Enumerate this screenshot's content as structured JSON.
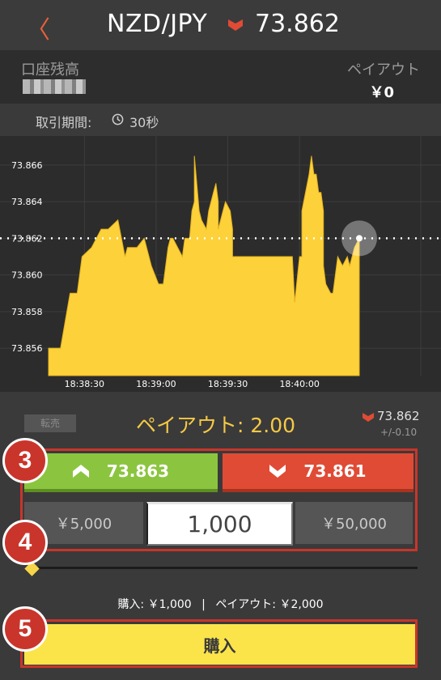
{
  "header": {
    "back_label": "〈",
    "pair": "NZD/JPY",
    "trend": "down",
    "rate": "73.862"
  },
  "account": {
    "balance_label": "口座残高",
    "payout_label": "ペイアウト",
    "payout_value": "￥0"
  },
  "period": {
    "label": "取引期間:",
    "value": "30秒"
  },
  "chart_data": {
    "type": "area",
    "y_ticks": [
      "73.866",
      "73.864",
      "73.862",
      "73.860",
      "73.858",
      "73.856"
    ],
    "x_ticks": [
      "18:38:30",
      "18:39:00",
      "18:39:30",
      "18:40:00"
    ],
    "ylim": [
      73.8545,
      73.8675
    ],
    "current_price": 73.862,
    "color": "#fdd13a",
    "x": [
      0,
      5,
      9,
      12,
      14,
      18,
      22,
      25,
      29,
      32,
      33,
      37,
      40,
      42,
      43,
      46,
      48,
      50,
      51,
      52,
      54,
      56,
      57,
      59,
      60,
      61,
      61,
      63,
      64,
      66,
      67,
      69,
      70,
      71,
      71,
      73,
      74,
      76,
      77,
      77,
      80,
      85,
      90,
      95,
      98,
      102,
      103,
      105,
      106,
      106,
      109,
      110,
      111,
      112,
      113,
      114,
      115,
      115,
      116,
      118,
      119,
      121,
      123,
      125,
      126,
      128,
      130
    ],
    "values": [
      73.856,
      73.856,
      73.859,
      73.859,
      73.861,
      73.8615,
      73.8625,
      73.8625,
      73.863,
      73.861,
      73.8615,
      73.8615,
      73.862,
      73.861,
      73.8605,
      73.8595,
      73.8595,
      73.8615,
      73.862,
      73.862,
      73.8615,
      73.861,
      73.862,
      73.862,
      73.8635,
      73.864,
      73.8665,
      73.8635,
      73.863,
      73.8625,
      73.8635,
      73.8645,
      73.865,
      73.864,
      73.8625,
      73.8635,
      73.864,
      73.8635,
      73.8625,
      73.861,
      73.861,
      73.861,
      73.861,
      73.861,
      73.861,
      73.861,
      73.8585,
      73.861,
      73.861,
      73.8635,
      73.8655,
      73.8665,
      73.8655,
      73.8655,
      73.8645,
      73.8645,
      73.8635,
      73.8605,
      73.8595,
      73.859,
      73.859,
      73.861,
      73.8605,
      73.861,
      73.8605,
      73.8615,
      73.862
    ],
    "x_tick_pos": [
      15,
      45,
      75,
      105
    ]
  },
  "order": {
    "resell_label": "転売",
    "payout_rate": "ペイアウト: 2.00",
    "current_rate": "73.862",
    "spread": "+/-0.10",
    "high_rate": "73.863",
    "low_rate": "73.861",
    "amount_left": "￥5,000",
    "amount_value": "1,000",
    "amount_right": "￥50,000",
    "summary_purchase": "購入: ￥1,000",
    "summary_sep": "|",
    "summary_payout": "ペイアウト: ￥2,000",
    "buy_label": "購入"
  },
  "badges": [
    "3",
    "4",
    "5"
  ],
  "colors": {
    "high": "#8bc53f",
    "low": "#e04b35",
    "accent": "#f6c945",
    "highlight": "#c9352b",
    "buy": "#fbe44a"
  }
}
